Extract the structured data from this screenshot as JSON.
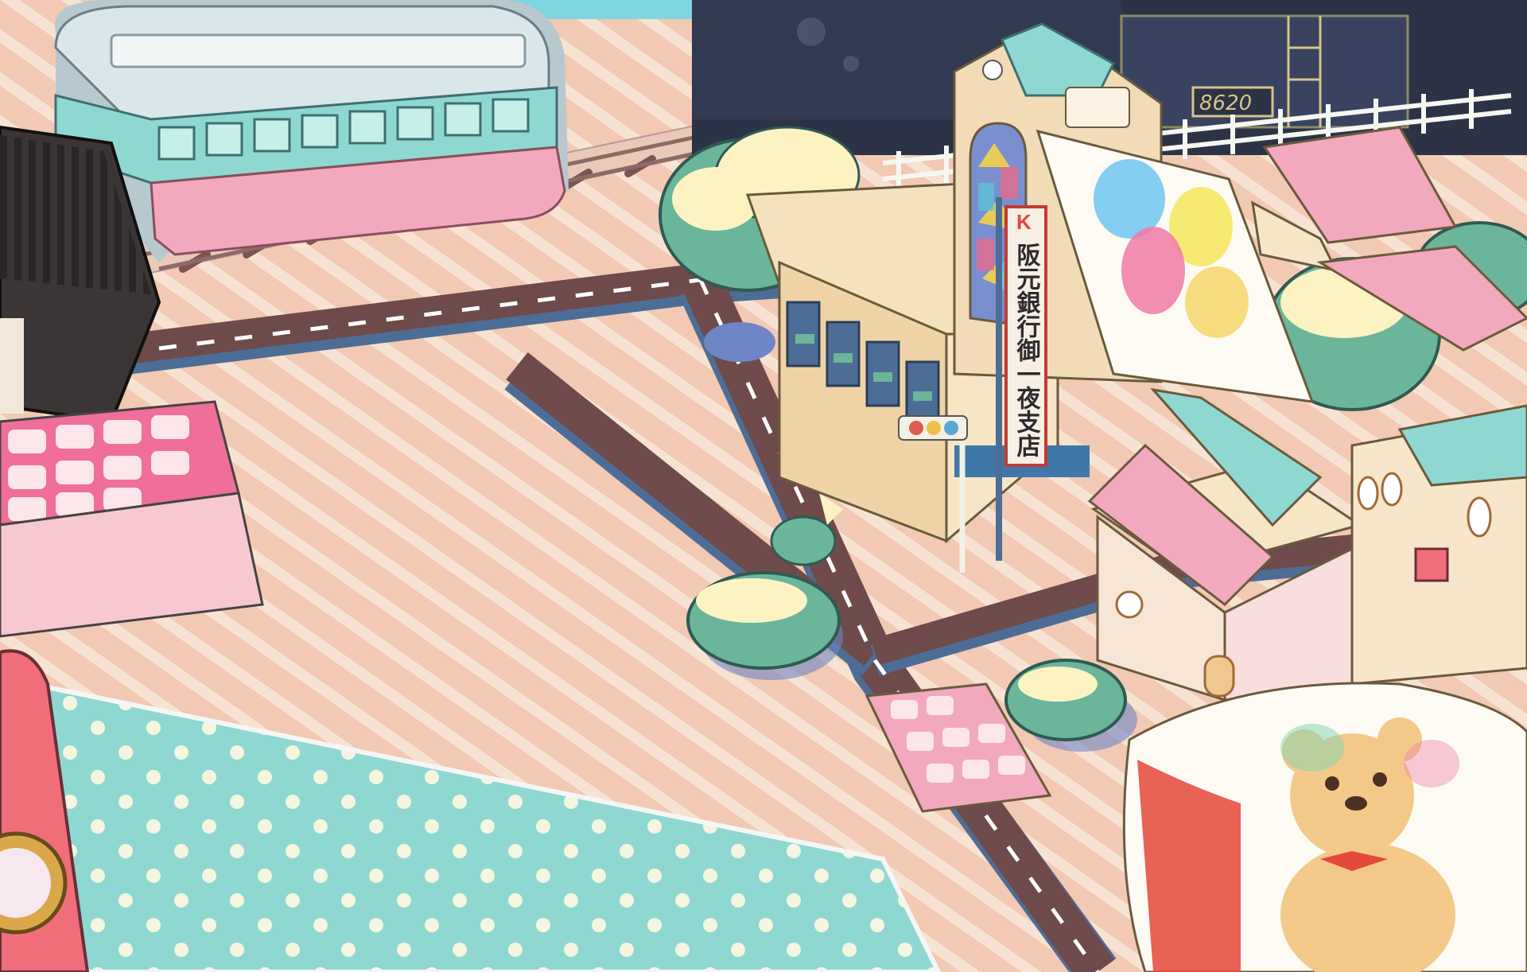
{
  "scene": {
    "kind": "illustrated town map",
    "palette": {
      "ground": "#f2c9b3",
      "ground_stripe": "#f7e3d2",
      "road": "#6e4a4a",
      "road_edge": "#4d6d96",
      "teal": "#8fd8d2",
      "pink": "#f3a9bd",
      "cream": "#f6e6c6",
      "tree": "#6bb59b",
      "tree_highlight": "#fdf3c2",
      "train_dark": "#2c3347"
    }
  },
  "locomotive": {
    "number": "8620"
  },
  "bank": {
    "logo": "K",
    "sign_lines": [
      "阪元銀行",
      "御一夜支店"
    ]
  },
  "traffic_light": {
    "lamps": [
      "#e05a4f",
      "#f0c04a",
      "#5aa6d8"
    ]
  },
  "flags": {
    "color_flag_blobs": [
      "#6ec6f0",
      "#f6e65a",
      "#f07aa6",
      "#f6d66a"
    ],
    "bear_flag": {
      "subject": "teddy bear",
      "bow_color": "#e4483a"
    }
  }
}
